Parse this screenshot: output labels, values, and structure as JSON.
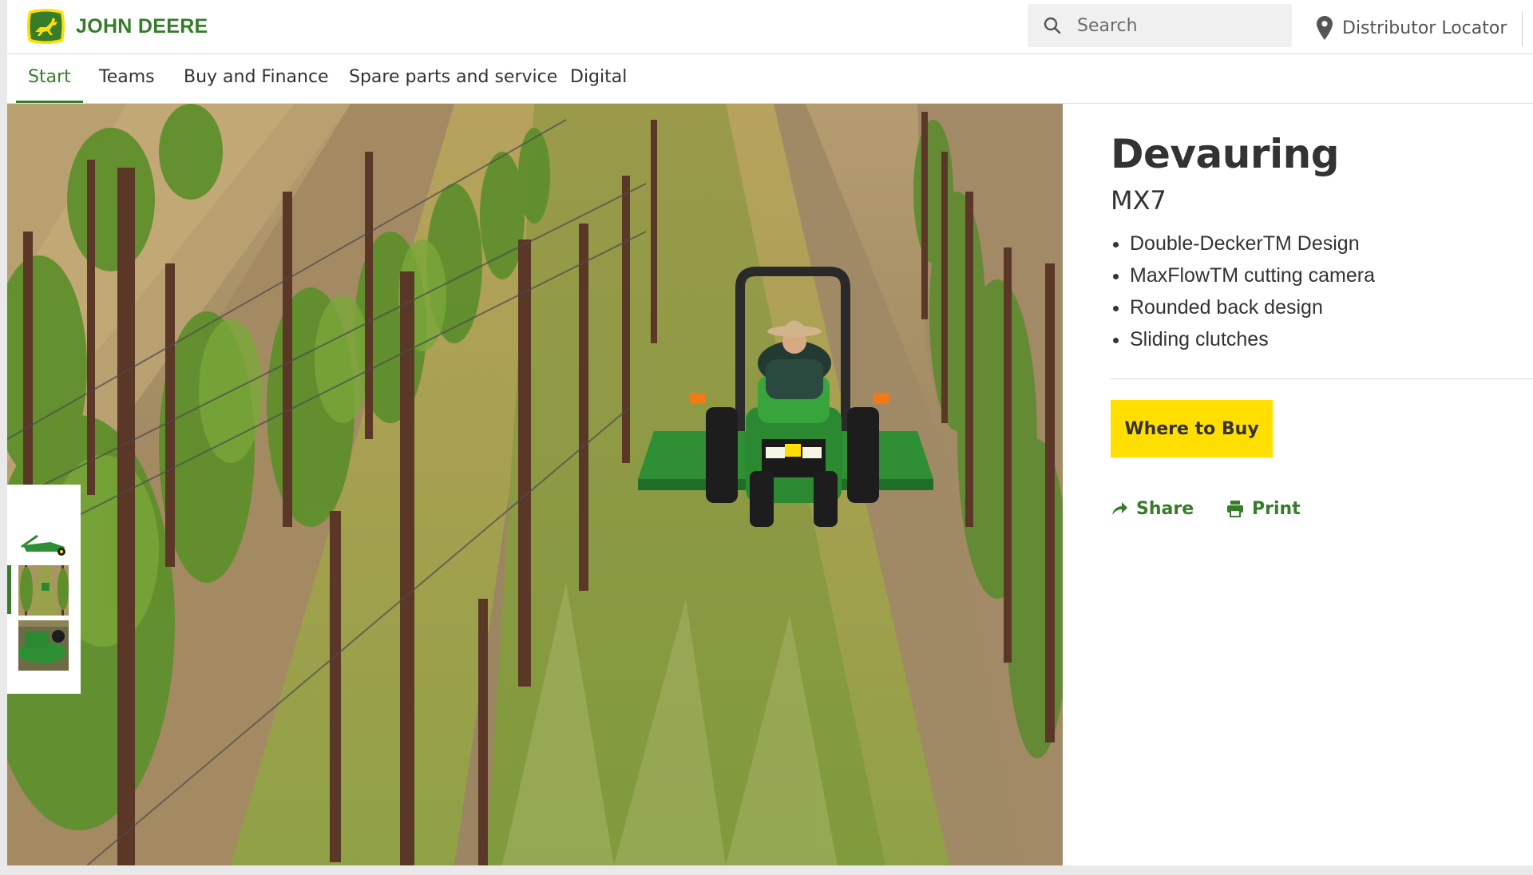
{
  "brand": {
    "name": "JOHN DEERE",
    "logo_icon": "deer-logo-icon",
    "color": "#367c2b"
  },
  "header": {
    "search": {
      "placeholder": "Search",
      "icon": "search-icon"
    },
    "locator": {
      "label": "Distributor Locator",
      "icon": "map-pin-icon"
    }
  },
  "nav": {
    "tabs": [
      {
        "label": "Start",
        "active": true
      },
      {
        "label": "Teams",
        "active": false
      },
      {
        "label": "Buy and Finance",
        "active": false
      },
      {
        "label": "Spare parts and service",
        "active": false
      },
      {
        "label": "Digital",
        "active": false
      }
    ]
  },
  "gallery": {
    "thumbnails": [
      {
        "subject": "rotary cutter product shot",
        "active": false
      },
      {
        "subject": "tractor with mower in vineyard",
        "active": true
      },
      {
        "subject": "mower close-up",
        "active": false
      }
    ]
  },
  "product": {
    "title": "Devauring",
    "model": "MX7",
    "features": [
      "Double-DeckerTM Design",
      "MaxFlowTM cutting camera",
      "Rounded back design",
      "Sliding clutches"
    ],
    "cta_label": "Where to Buy",
    "cta_color": "#ffde00",
    "share_label": "Share",
    "print_label": "Print"
  }
}
